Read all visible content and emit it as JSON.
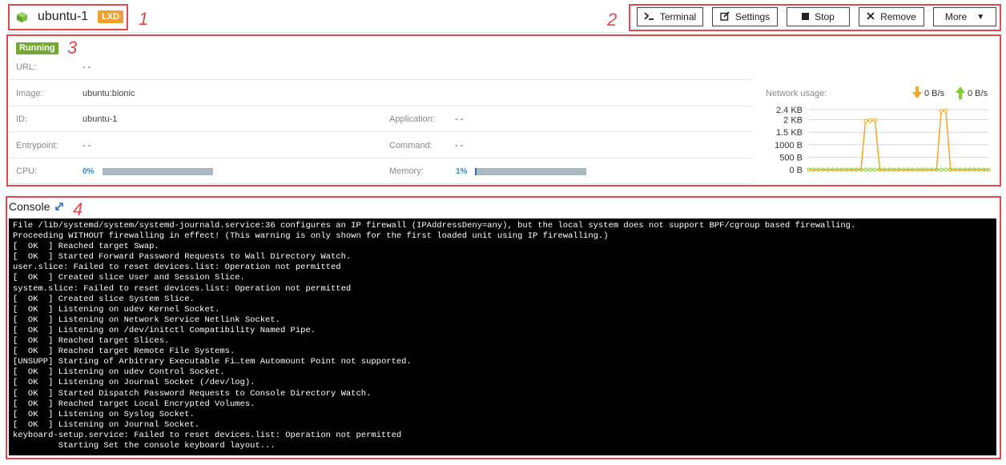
{
  "header": {
    "title": "ubuntu-1",
    "badge": "LXD",
    "buttons": {
      "terminal": "Terminal",
      "settings": "Settings",
      "stop": "Stop",
      "remove": "Remove",
      "more": "More"
    }
  },
  "annotations": [
    "1",
    "2",
    "3",
    "4"
  ],
  "details": {
    "status": "Running",
    "url": {
      "label": "URL:",
      "value": "- -"
    },
    "image": {
      "label": "Image:",
      "value": "ubuntu:bionic"
    },
    "id": {
      "label": "ID:",
      "value": "ubuntu-1"
    },
    "application": {
      "label": "Application:",
      "value": "- -"
    },
    "entrypoint": {
      "label": "Entrypoint:",
      "value": "- -"
    },
    "command": {
      "label": "Command:",
      "value": "- -"
    },
    "cpu": {
      "label": "CPU:",
      "value": "0%",
      "fraction": 0.0
    },
    "memory": {
      "label": "Memory:",
      "value": "1%",
      "fraction": 0.01
    }
  },
  "network": {
    "label": "Network usage:",
    "down_rate": "0 B/s",
    "up_rate": "0 B/s",
    "colors": {
      "down": "#f5a623",
      "up": "#7ed321"
    }
  },
  "chart_data": {
    "type": "line",
    "y_ticks": [
      "2.4 KB",
      "2 KB",
      "1.5 KB",
      "1000 B",
      "500 B",
      "0 B"
    ],
    "ylim": [
      0,
      2400
    ],
    "x": [
      0,
      1,
      2,
      3,
      4,
      5,
      6,
      7,
      8,
      9,
      10,
      11,
      12,
      13,
      14,
      15,
      16,
      17,
      18,
      19,
      20,
      21,
      22,
      23,
      24,
      25,
      26,
      27,
      28,
      29,
      30,
      31,
      32,
      33,
      34,
      35,
      36,
      37,
      38
    ],
    "series": [
      {
        "values": [
          0,
          0,
          0,
          0,
          0,
          0,
          0,
          0,
          0,
          0,
          0,
          0,
          0,
          0,
          0,
          0,
          0,
          0,
          0,
          0,
          0,
          0,
          0,
          0,
          0,
          0,
          0,
          0,
          0,
          0,
          0,
          0,
          0,
          0,
          0,
          0,
          0,
          0,
          0
        ]
      },
      {
        "values": [
          0,
          0,
          0,
          0,
          0,
          0,
          0,
          0,
          0,
          0,
          0,
          0,
          1950,
          1970,
          1980,
          0,
          0,
          0,
          0,
          0,
          0,
          0,
          0,
          0,
          0,
          0,
          0,
          0,
          2350,
          2360,
          0,
          0,
          0,
          0,
          0,
          0,
          0,
          0,
          0
        ]
      }
    ],
    "grid": true
  },
  "console": {
    "title": "Console",
    "lines": [
      "File /lib/systemd/system/systemd-journald.service:36 configures an IP firewall (IPAddressDeny=any), but the local system does not support BPF/cgroup based firewalling.",
      "Proceeding WITHOUT firewalling in effect! (This warning is only shown for the first loaded unit using IP firewalling.)",
      "[  OK  ] Reached target Swap.",
      "[  OK  ] Started Forward Password Requests to Wall Directory Watch.",
      "user.slice: Failed to reset devices.list: Operation not permitted",
      "[  OK  ] Created slice User and Session Slice.",
      "system.slice: Failed to reset devices.list: Operation not permitted",
      "[  OK  ] Created slice System Slice.",
      "[  OK  ] Listening on udev Kernel Socket.",
      "[  OK  ] Listening on Network Service Netlink Socket.",
      "[  OK  ] Listening on /dev/initctl Compatibility Named Pipe.",
      "[  OK  ] Reached target Slices.",
      "[  OK  ] Reached target Remote File Systems.",
      "[UNSUPP] Starting of Arbitrary Executable Fi…tem Automount Point not supported.",
      "[  OK  ] Listening on udev Control Socket.",
      "[  OK  ] Listening on Journal Socket (/dev/log).",
      "[  OK  ] Started Dispatch Password Requests to Console Directory Watch.",
      "[  OK  ] Reached target Local Encrypted Volumes.",
      "[  OK  ] Listening on Syslog Socket.",
      "[  OK  ] Listening on Journal Socket.",
      "keyboard-setup.service: Failed to reset devices.list: Operation not permitted",
      "         Starting Set the console keyboard layout..."
    ]
  }
}
